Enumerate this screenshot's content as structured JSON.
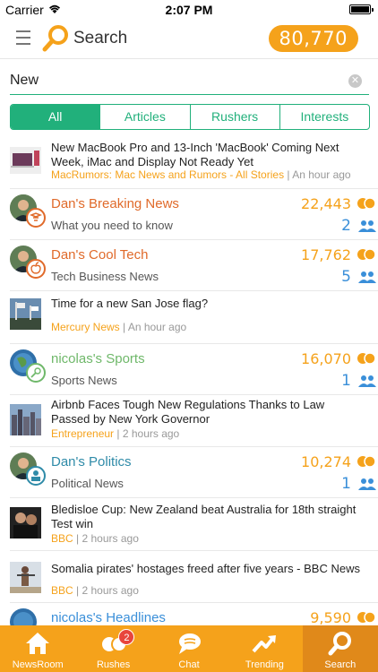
{
  "status": {
    "carrier": "Carrier",
    "time": "2:07 PM"
  },
  "nav": {
    "title": "Search",
    "score": "80,770"
  },
  "search": {
    "value": "New"
  },
  "segments": [
    "All",
    "Articles",
    "Rushers",
    "Interests"
  ],
  "rows": [
    {
      "title": "New MacBook Pro and 13-Inch 'MacBook' Coming Next Week, iMac and Display Not Ready Yet",
      "source": "MacRumors: Mac News and Rumors - All Stories",
      "time": "An hour ago"
    },
    {
      "name": "Dan's Breaking News",
      "sub": "What you need to know",
      "rushes": "22,443",
      "followers": "2",
      "color": "#e06a2a"
    },
    {
      "name": "Dan's Cool Tech",
      "sub": "Tech Business News",
      "rushes": "17,762",
      "followers": "5",
      "color": "#e06a2a"
    },
    {
      "title": "Time for a new San Jose flag?",
      "source": "Mercury News",
      "time": "An hour ago"
    },
    {
      "name": "nicolas's Sports",
      "sub": "Sports News",
      "rushes": "16,070",
      "followers": "1",
      "color": "#6fb86a"
    },
    {
      "title": "Airbnb Faces Tough New Regulations Thanks to Law Passed by New York Governor",
      "source": "Entrepreneur",
      "time": "2 hours ago"
    },
    {
      "name": "Dan's Politics",
      "sub": "Political News",
      "rushes": "10,274",
      "followers": "1",
      "color": "#2f8ba8"
    },
    {
      "title": "Bledisloe Cup: New Zealand beat Australia for 18th straight Test win",
      "source": "BBC",
      "time": "2 hours ago"
    },
    {
      "title": "Somalia pirates' hostages freed after five years - BBC News",
      "source": "BBC",
      "time": "2 hours ago"
    },
    {
      "name": "nicolas's Headlines",
      "rushes": "9,590"
    }
  ],
  "tabs": [
    "NewsRoom",
    "Rushes",
    "Chat",
    "Trending",
    "Search"
  ],
  "rushes_badge": "2",
  "colors": {
    "accent": "#f5a21b",
    "green": "#21b07b",
    "blue": "#3a8fd9"
  }
}
